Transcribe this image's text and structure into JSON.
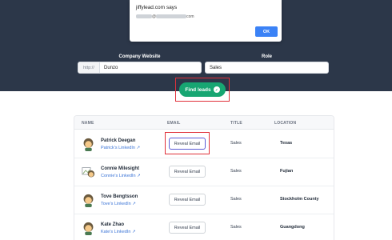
{
  "alert": {
    "title": "jiffylead.com says",
    "message_suffix": "com",
    "ok_label": "OK"
  },
  "search": {
    "website_label": "Company Website",
    "website_prefix": "http://",
    "website_value": "Dunzo",
    "role_label": "Role",
    "role_value": "Sales",
    "find_button": "Find leads"
  },
  "table": {
    "headers": [
      "NAME",
      "EMAIL",
      "TITLE",
      "LOCATION"
    ],
    "rows": [
      {
        "name": "Patrick Deegan",
        "linkedin": "Patrick's LinkedIn ↗",
        "reveal": "Reveal Email",
        "title": "Sales",
        "location": "Texas"
      },
      {
        "name": "Connie Milesight",
        "linkedin": "Connie's LinkedIn ↗",
        "reveal": "Reveal Email",
        "title": "Sales",
        "location": "Fujian"
      },
      {
        "name": "Tove Bengtsson",
        "linkedin": "Tove's LinkedIn ↗",
        "reveal": "Reveal Email",
        "title": "Sales",
        "location": "Stockholm County"
      },
      {
        "name": "Kate Zhao",
        "linkedin": "Kate's LinkedIn ↗",
        "reveal": "Reveal Email",
        "title": "Sales",
        "location": "Guangdong"
      }
    ]
  },
  "colors": {
    "hero_bg": "#2c3749",
    "find_button": "#17a672",
    "highlight": "#e0313a",
    "link": "#3b74d6",
    "ok_button": "#3b82f6"
  }
}
